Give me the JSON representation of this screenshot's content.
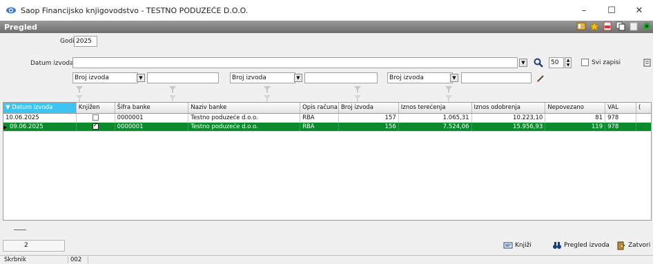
{
  "window": {
    "title": "Saop Financijsko knjigovodstvo - TESTNO PODUZEĆE D.O.O.",
    "minimize": "–",
    "maximize": "☐",
    "close": "✕"
  },
  "header": {
    "title": "Pregled"
  },
  "form": {
    "godina_label": "Godina",
    "godina_value": "2025",
    "datum_label": "Datum izvoda",
    "datum_value": "",
    "limit_value": "50",
    "svi_zapisi_label": "Svi zapisi",
    "filters": [
      {
        "field": "Broj izvoda",
        "value": ""
      },
      {
        "field": "Broj izvoda",
        "value": ""
      },
      {
        "field": "Broj izvoda",
        "value": ""
      }
    ]
  },
  "grid": {
    "columns": [
      "Datum izvoda",
      "Knjižen",
      "Šifra banke",
      "Naziv banke",
      "Opis računa",
      "Broj izvoda",
      "Iznos terećenja",
      "Iznos odobrenja",
      "Nepovezano",
      "VAL",
      "("
    ],
    "rows": [
      {
        "datum": "10.06.2025",
        "knjizen": false,
        "sifra": "0000001",
        "naziv": "Testno poduzeće d.o.o.",
        "opis": "RBA",
        "broj": "157",
        "teret": "1.065,31",
        "odobr": "10.223,10",
        "nepov": "81",
        "val": "978",
        "selected": false
      },
      {
        "datum": "09.06.2025",
        "knjizen": true,
        "sifra": "0000001",
        "naziv": "Testno poduzeće d.o.o.",
        "opis": "RBA",
        "broj": "156",
        "teret": "7.524,06",
        "odobr": "15.956,93",
        "nepov": "119",
        "val": "978",
        "selected": true
      }
    ]
  },
  "footer": {
    "count": "2",
    "knjizi_label": "Knjiži",
    "pregled_label": "Pregled izvoda",
    "zatvori_label": "Zatvori"
  },
  "status": {
    "user": "Skrbnik",
    "code": "002"
  },
  "colors": {
    "selected_row": "#0c8a2e",
    "sorted_header": "#3ec4f3"
  }
}
